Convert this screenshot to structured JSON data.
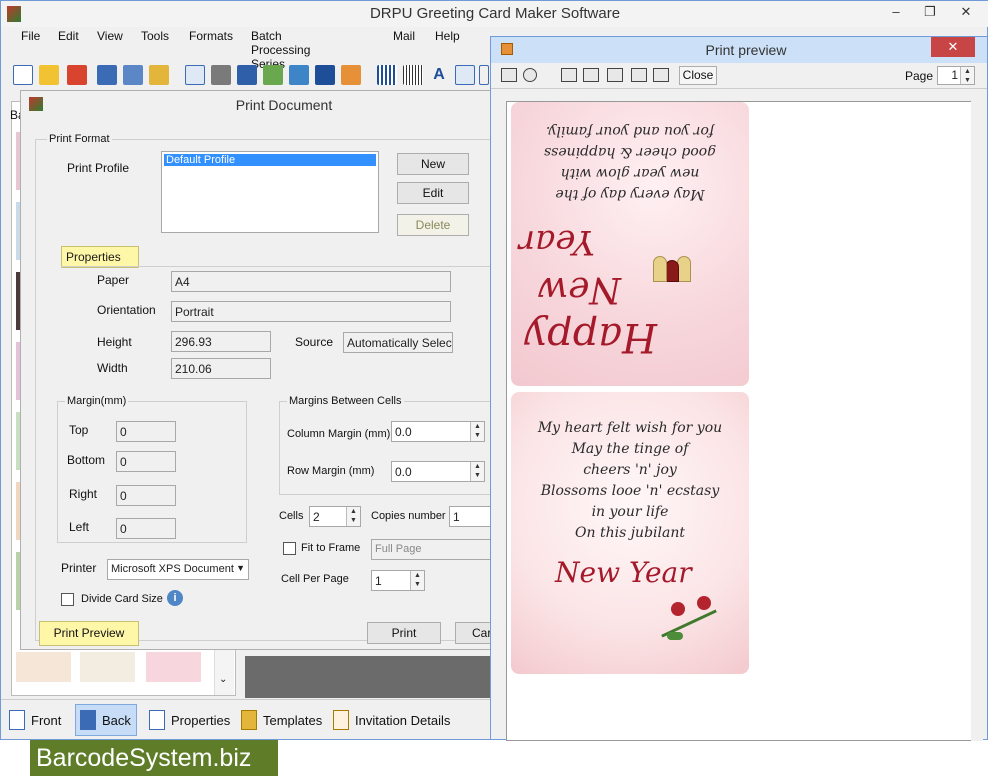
{
  "app": {
    "title": "DRPU Greeting Card Maker Software",
    "window_controls": [
      "–",
      "❐",
      "✕"
    ]
  },
  "menu": [
    "File",
    "Edit",
    "View",
    "Tools",
    "Formats",
    "Batch Processing Series",
    "Mail",
    "Help"
  ],
  "left_panel": {
    "label_fragment": "Ba"
  },
  "bottom_tabs": [
    {
      "label": "Front"
    },
    {
      "label": "Back"
    },
    {
      "label": "Properties"
    },
    {
      "label": "Templates"
    },
    {
      "label": "Invitation Details"
    }
  ],
  "print_dialog": {
    "title": "Print Document",
    "print_format_label": "Print Format",
    "print_profile_label": "Print Profile",
    "profile_selected": "Default Profile",
    "new_button": "New",
    "edit_button": "Edit",
    "delete_button": "Delete",
    "properties_tab": "Properties",
    "paper_label": "Paper",
    "paper_value": "A4",
    "orientation_label": "Orientation",
    "orientation_value": "Portrait",
    "height_label": "Height",
    "height_value": "296.93",
    "width_label": "Width",
    "width_value": "210.06",
    "source_label": "Source",
    "source_value": "Automatically Select",
    "margin_group": "Margin(mm)",
    "top_label": "Top",
    "top_value": "0",
    "bottom_label": "Bottom",
    "bottom_value": "0",
    "right_label": "Right",
    "right_value": "0",
    "left_label": "Left",
    "left_value": "0",
    "cells_margin_group": "Margins Between Cells",
    "column_margin_label": "Column Margin (mm)",
    "column_margin_value": "0.0",
    "row_margin_label": "Row Margin (mm)",
    "row_margin_value": "0.0",
    "cells_label": "Cells",
    "cells_value": "2",
    "copies_label": "Copies number",
    "copies_value": "1",
    "fit_to_frame_label": "Fit to Frame",
    "fit_option": "Full Page",
    "cell_per_page_label": "Cell Per Page",
    "cell_per_page_value": "1",
    "printer_label": "Printer",
    "printer_value": "Microsoft XPS Document",
    "divide_card_label": "Divide Card Size",
    "print_preview_button": "Print Preview",
    "print_button": "Print",
    "cancel_button": "Car"
  },
  "preview": {
    "title": "Print preview",
    "close_label": "Close",
    "page_label": "Page",
    "page_value": "1",
    "card_top_verse": [
      "May every day of the",
      "new year glow with",
      "good cheer & happiness",
      "for you and your family."
    ],
    "card_top_script_1": "Happy",
    "card_top_script_2": "New",
    "card_top_script_3": "Year",
    "card_bottom_verse": [
      "My heart felt wish for you",
      "May the tinge of",
      "cheers 'n' joy",
      "Blossoms looe 'n' ecstasy",
      "in your life",
      "On this jubilant"
    ],
    "card_bottom_script": "New Year"
  },
  "watermark": "BarcodeSystem.biz",
  "colors": {
    "accent": "#3b6bb5",
    "close_red": "#c74545",
    "script_red": "#a51a2a",
    "highlight_yellow": "#fff7a8",
    "watermark_green": "#5f7d28"
  }
}
